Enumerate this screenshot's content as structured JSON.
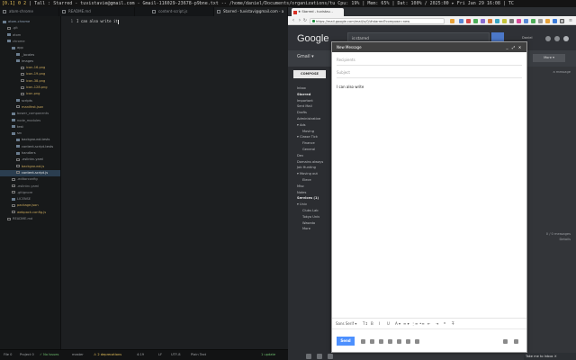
{
  "sysbar": {
    "workspace": "[0.1] 0 2",
    "text": " | Tall : Starred - tuvistavie@gmail.com - Gmail-116029-23678-p9bne.txt -- /home/daniel/Documents/organizations/tu   Cpu: 19% | Mem: 65% | Dat: 100% / 2025:00 ▸  Fri Jan 29 16:08 |  TC"
  },
  "editor": {
    "tabs": [
      {
        "label": "atom-chrome"
      },
      {
        "label": "README.md"
      },
      {
        "label": "content-script.js"
      },
      {
        "label": "Starred - tuvistavi@gmail.com - a"
      }
    ],
    "tree": [
      {
        "label": "atom-chrome",
        "indent": 0,
        "color": "#8fa0b4"
      },
      {
        "label": ".git",
        "indent": 1,
        "color": "#8b8e92"
      },
      {
        "label": "atom",
        "indent": 1,
        "color": "#8b8e92"
      },
      {
        "label": "chrome",
        "indent": 1,
        "color": "#8b8e92"
      },
      {
        "label": "app",
        "indent": 2,
        "color": "#9ca0a4"
      },
      {
        "label": "_locales",
        "indent": 3,
        "color": "#9ca0a4"
      },
      {
        "label": "images",
        "indent": 3,
        "color": "#9ca0a4"
      },
      {
        "label": "icon-16.png",
        "indent": 4,
        "color": "#c9a85c"
      },
      {
        "label": "icon-19.png",
        "indent": 4,
        "color": "#c9a85c"
      },
      {
        "label": "icon-38.png",
        "indent": 4,
        "color": "#c9a85c"
      },
      {
        "label": "icon-128.png",
        "indent": 4,
        "color": "#c9a85c"
      },
      {
        "label": "icon.png",
        "indent": 4,
        "color": "#c9a85c"
      },
      {
        "label": "scripts",
        "indent": 3,
        "color": "#9ca0a4"
      },
      {
        "label": "manifest.json",
        "indent": 3,
        "color": "#c9a85c"
      },
      {
        "label": "bower_components",
        "indent": 2,
        "color": "#8b8e92"
      },
      {
        "label": "node_modules",
        "indent": 2,
        "color": "#8b8e92"
      },
      {
        "label": "test",
        "indent": 2,
        "color": "#9ca0a4"
      },
      {
        "label": "src",
        "indent": 2,
        "color": "#9ca0a4"
      },
      {
        "label": "background-tests",
        "indent": 3,
        "color": "#9ca0a4"
      },
      {
        "label": "content-script-tests",
        "indent": 3,
        "color": "#9ca0a4"
      },
      {
        "label": "handlers",
        "indent": 3,
        "color": "#9ca0a4"
      },
      {
        "label": ".eslintrc.yaml",
        "indent": 3,
        "color": "#9ca0a4"
      },
      {
        "label": "background.js",
        "indent": 3,
        "color": "#c9a85c"
      },
      {
        "label": "content-script.js",
        "indent": 3,
        "color": "#e5e5e5"
      },
      {
        "label": ".editorconfig",
        "indent": 2,
        "color": "#8b8e92"
      },
      {
        "label": ".eslintrc.yaml",
        "indent": 2,
        "color": "#8b8e92"
      },
      {
        "label": ".gitignore",
        "indent": 2,
        "color": "#8b8e92"
      },
      {
        "label": "LICENSE",
        "indent": 2,
        "color": "#8b8e92"
      },
      {
        "label": "package.json",
        "indent": 2,
        "color": "#c9a85c"
      },
      {
        "label": "webpack.config.js",
        "indent": 2,
        "color": "#c9a85c"
      },
      {
        "label": "README.md",
        "indent": 1,
        "color": "#8b8e92"
      }
    ],
    "line_number": "1",
    "code_text": "I can also write it",
    "status": {
      "file": "File 0",
      "project": "Project 0",
      "no_issues": "✓ No Issues",
      "branch": "master",
      "deprecations": "⚠ 2 deprecations",
      "cursor": "4:19",
      "line_info": "LF",
      "encoding": "UTF-8",
      "grammar": "Plain Text",
      "updates": "1 update"
    }
  },
  "browser": {
    "tab_title": "★ Starred - tuvistav...",
    "url": "https://mail.google.com/mail/u/0/#starred?compose=new",
    "logo": "Google",
    "search_value": "is:starred",
    "user_name": "Daniel",
    "gmail_label": "Gmail ▾",
    "more_label": "More ▾",
    "compose_label": "COMPOSE",
    "nav": [
      {
        "label": "Inbox",
        "bold": false,
        "indent": 0
      },
      {
        "label": "Starred",
        "bold": true,
        "indent": 0
      },
      {
        "label": "Important",
        "bold": false,
        "indent": 0
      },
      {
        "label": "Sent Mail",
        "bold": false,
        "indent": 0
      },
      {
        "label": "Drafts",
        "bold": false,
        "indent": 0
      },
      {
        "label": "Administrative",
        "bold": false,
        "indent": 0
      },
      {
        "label": "▾ Ads",
        "bold": false,
        "indent": 0
      },
      {
        "label": "Moving",
        "bold": false,
        "indent": 1
      },
      {
        "label": "▾ Classe Tick",
        "bold": false,
        "indent": 0
      },
      {
        "label": "Finance",
        "bold": false,
        "indent": 1
      },
      {
        "label": "General",
        "bold": false,
        "indent": 1
      },
      {
        "label": "Dev",
        "bold": false,
        "indent": 0
      },
      {
        "label": "Domains always",
        "bold": false,
        "indent": 0
      },
      {
        "label": "Job Hunting",
        "bold": false,
        "indent": 0
      },
      {
        "label": "▾ Moving out",
        "bold": false,
        "indent": 0
      },
      {
        "label": "Elece",
        "bold": false,
        "indent": 1
      },
      {
        "label": "Misc",
        "bold": false,
        "indent": 0
      },
      {
        "label": "Notes",
        "bold": false,
        "indent": 0
      },
      {
        "label": "Services (1)",
        "bold": true,
        "indent": 0
      },
      {
        "label": "▾ Univ",
        "bold": false,
        "indent": 0
      },
      {
        "label": "Clubs Lab",
        "bold": false,
        "indent": 1
      },
      {
        "label": "Tokyo Univ",
        "bold": false,
        "indent": 1
      },
      {
        "label": "Waseda",
        "bold": false,
        "indent": 1
      },
      {
        "label": "More",
        "bold": false,
        "indent": 1
      }
    ],
    "right_texts": [
      {
        "label": "a message"
      },
      {
        "label": "0 / 0 messages"
      },
      {
        "label": "Details"
      }
    ],
    "compose": {
      "title": "New Message",
      "recipients_placeholder": "Recipients",
      "subject_placeholder": "Subject",
      "body": "I can also write",
      "font_label": "Sans Serif ▾",
      "send_label": "Send",
      "ctrl_minimize": "_",
      "ctrl_expand": "⤢",
      "ctrl_close": "✕",
      "format_items": [
        {
          "label": "T↕"
        },
        {
          "label": "B"
        },
        {
          "label": "I"
        },
        {
          "label": "U"
        },
        {
          "label": "A ▾"
        },
        {
          "label": "≡ ▾"
        },
        {
          "label": "⋮≡"
        },
        {
          "label": "•≡"
        },
        {
          "label": "⇤"
        },
        {
          "label": "⇥"
        },
        {
          "label": "❝"
        },
        {
          "label": "T̶"
        }
      ]
    },
    "tip": "Take me to Inbox ✕"
  }
}
